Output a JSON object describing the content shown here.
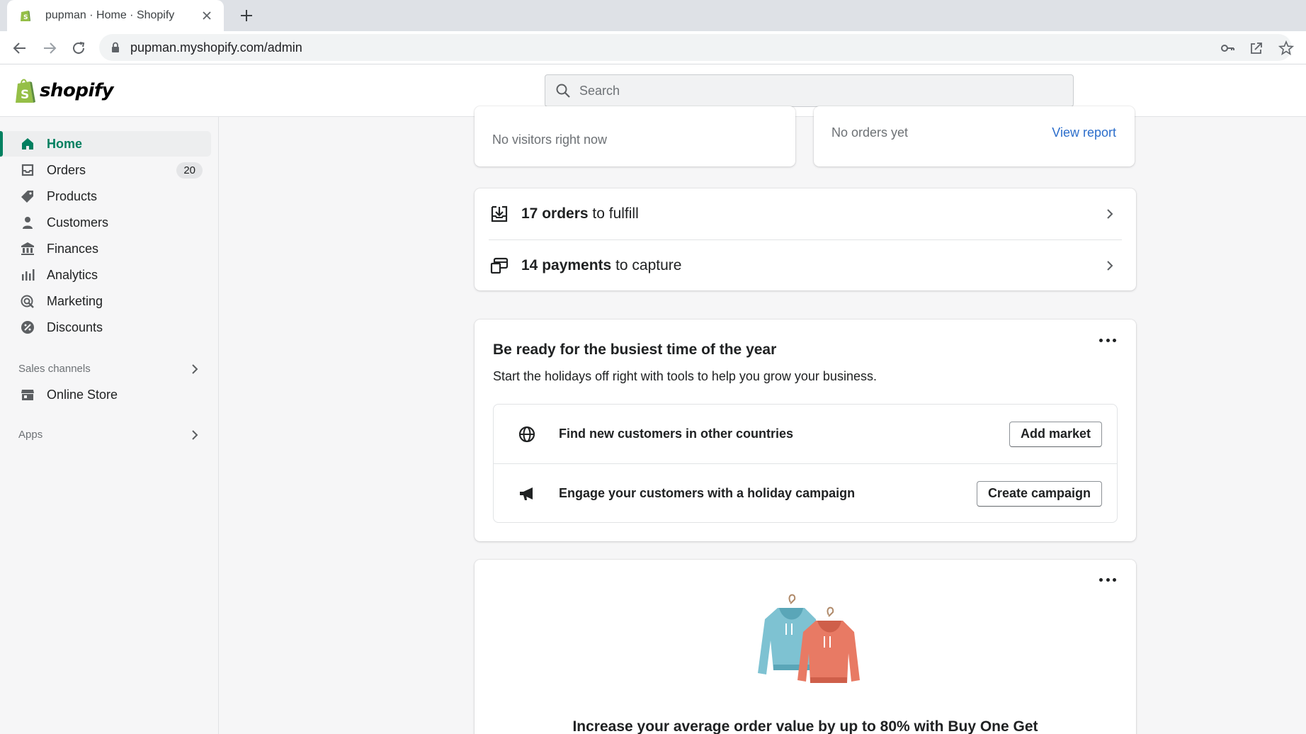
{
  "browser": {
    "tab_title": "pupman · Home · Shopify",
    "url": "pupman.myshopify.com/admin"
  },
  "header": {
    "logo_text": "shopify",
    "search_placeholder": "Search"
  },
  "sidebar": {
    "items": [
      {
        "label": "Home",
        "icon": "home-icon",
        "active": true
      },
      {
        "label": "Orders",
        "icon": "orders-icon",
        "badge": "20"
      },
      {
        "label": "Products",
        "icon": "tag-icon"
      },
      {
        "label": "Customers",
        "icon": "person-icon"
      },
      {
        "label": "Finances",
        "icon": "bank-icon"
      },
      {
        "label": "Analytics",
        "icon": "bar-chart-icon"
      },
      {
        "label": "Marketing",
        "icon": "target-icon"
      },
      {
        "label": "Discounts",
        "icon": "discount-icon"
      }
    ],
    "sales_channels_label": "Sales channels",
    "online_store_label": "Online Store",
    "apps_label": "Apps"
  },
  "main": {
    "visitors_text": "No visitors right now",
    "orders_text": "No orders yet",
    "view_report": "View report",
    "tasks": [
      {
        "bold": "17 orders",
        "rest": " to fulfill",
        "icon": "fulfill-icon"
      },
      {
        "bold": "14 payments",
        "rest": " to capture",
        "icon": "payment-icon"
      }
    ],
    "holiday": {
      "title": "Be ready for the busiest time of the year",
      "subtitle": "Start the holidays off right with tools to help you grow your business.",
      "rows": [
        {
          "text": "Find new customers in other countries",
          "button": "Add market",
          "icon": "globe-icon"
        },
        {
          "text": "Engage your customers with a holiday campaign",
          "button": "Create campaign",
          "icon": "megaphone-icon"
        }
      ]
    },
    "promo": {
      "title": "Increase your average order value by up to 80% with Buy One Get",
      "illustration": "hoodies-illustration"
    }
  },
  "colors": {
    "accent": "#008060",
    "active_text": "#007f5f",
    "link": "#2c6ecb"
  }
}
